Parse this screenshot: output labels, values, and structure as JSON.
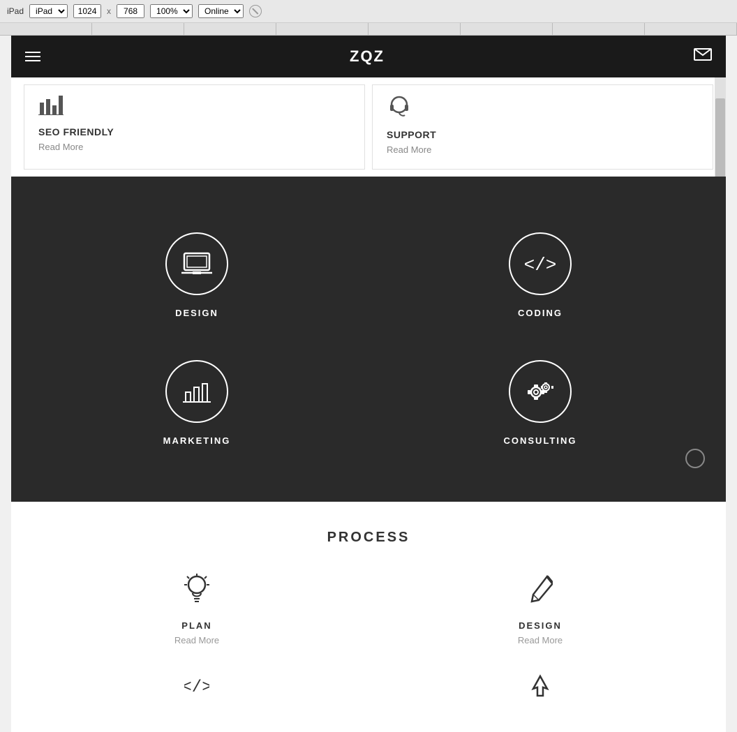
{
  "browser": {
    "device": "iPad",
    "width": "1024",
    "height": "768",
    "zoom": "100%",
    "status": "Online"
  },
  "header": {
    "logo": "ZQZ",
    "menu_icon": "hamburger",
    "mail_icon": "mail"
  },
  "cards": [
    {
      "icon": "seo",
      "title": "SEO FRIENDLY",
      "readmore": "Read More"
    },
    {
      "icon": "support",
      "title": "SUPPORT",
      "readmore": "Read More"
    }
  ],
  "services": [
    {
      "icon": "laptop",
      "label": "DESIGN"
    },
    {
      "icon": "code",
      "label": "CODING"
    },
    {
      "icon": "chart",
      "label": "MARKETING"
    },
    {
      "icon": "gear",
      "label": "CONSULTING"
    }
  ],
  "process": {
    "title": "PROCESS",
    "items": [
      {
        "icon": "bulb",
        "label": "PLAN",
        "readmore": "Read More"
      },
      {
        "icon": "brush",
        "label": "DESIGN",
        "readmore": "Read More"
      }
    ],
    "items_row2": [
      {
        "icon": "code",
        "label": ""
      },
      {
        "icon": "rocket",
        "label": ""
      }
    ]
  }
}
